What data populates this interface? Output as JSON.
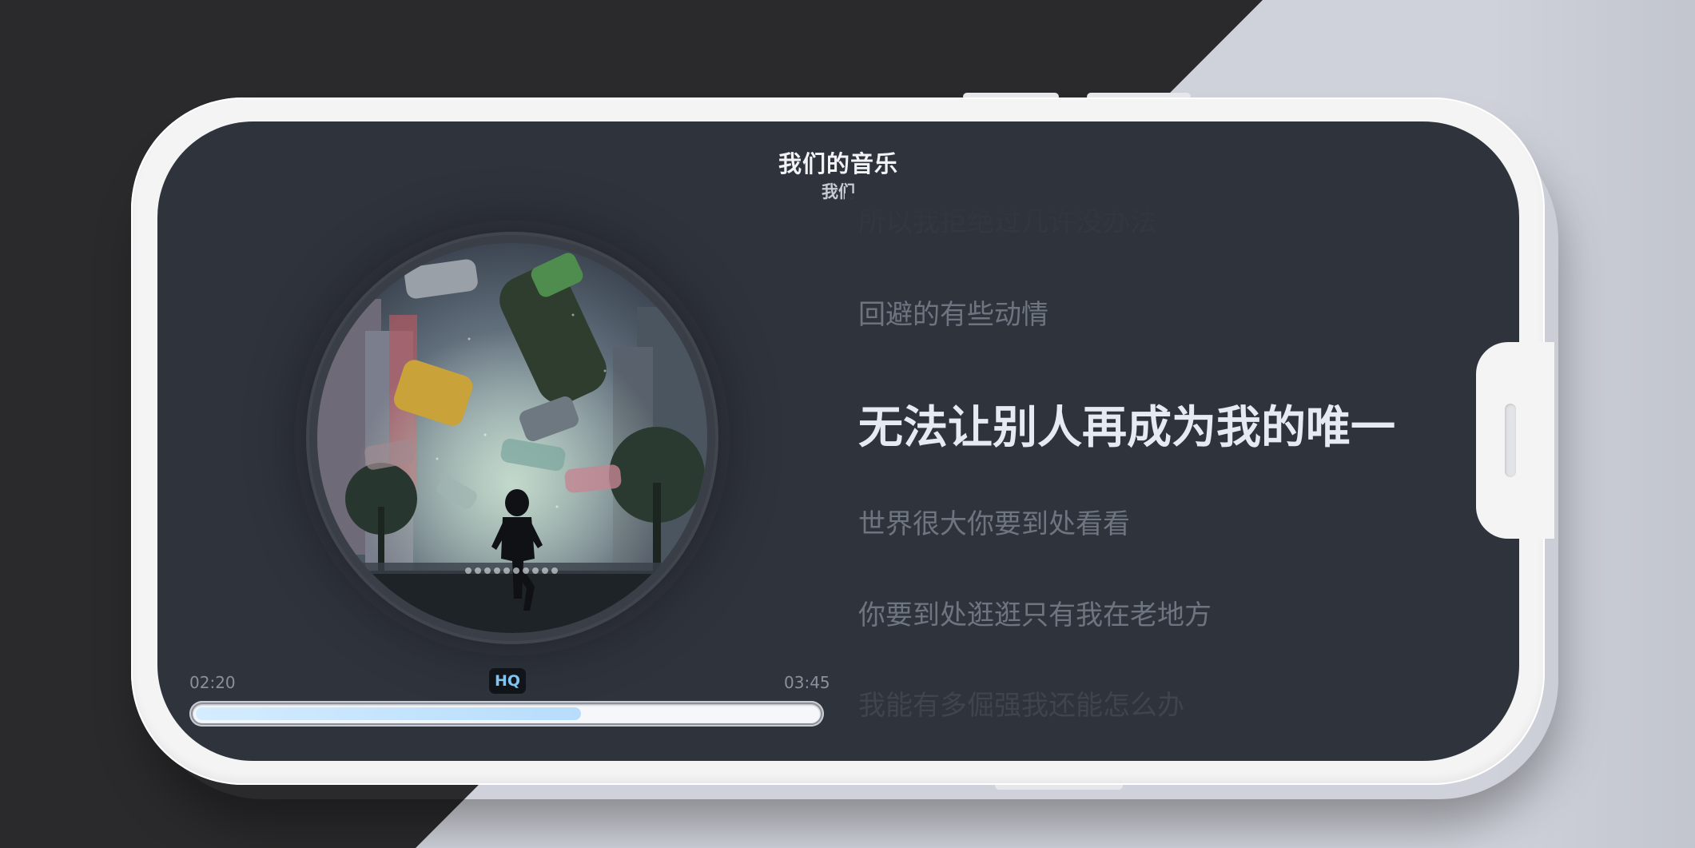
{
  "player": {
    "title": "我们的音乐",
    "artist": "我们",
    "elapsed": "02:20",
    "duration": "03:45",
    "quality_badge": "HQ",
    "progress_fraction": 0.62,
    "accent_color": "#b7ddfb"
  },
  "lyrics": [
    "所以我拒绝过几许没办法",
    "回避的有些动情",
    "无法让别人再成为我的唯一",
    "世界很大你要到处看看",
    "你要到处逛逛只有我在老地方",
    "我能有多倔强我还能怎么办"
  ],
  "lyrics_current_index": 2,
  "icons": {
    "cover_art": "album-cover-art"
  }
}
